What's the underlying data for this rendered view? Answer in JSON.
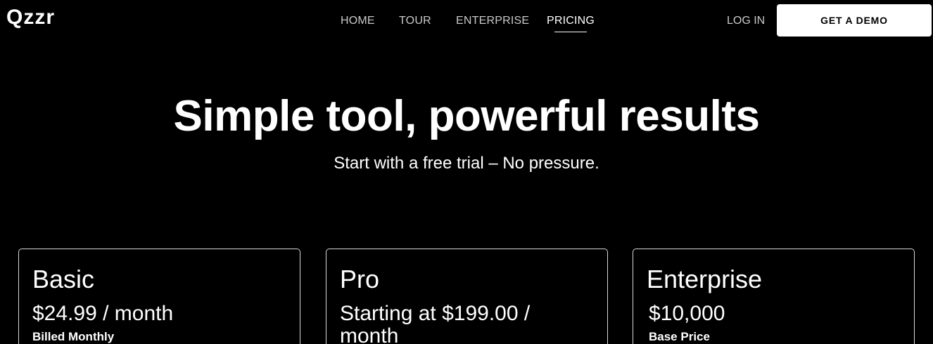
{
  "header": {
    "logo": "Qzzr",
    "nav": [
      "HOME",
      "TOUR",
      "ENTERPRISE",
      "PRICING"
    ],
    "active_nav": "PRICING",
    "login": "LOG IN",
    "demo_button": "GET A DEMO"
  },
  "hero": {
    "title": "Simple tool, powerful results",
    "subtitle": "Start with a free trial – No pressure."
  },
  "plans": [
    {
      "name": "Basic",
      "price": "$24.99 / month",
      "note": "Billed Monthly"
    },
    {
      "name": "Pro",
      "price": "Starting at $199.00 / month",
      "note": ""
    },
    {
      "name": "Enterprise",
      "price": "$10,000",
      "note": "Base Price"
    }
  ]
}
